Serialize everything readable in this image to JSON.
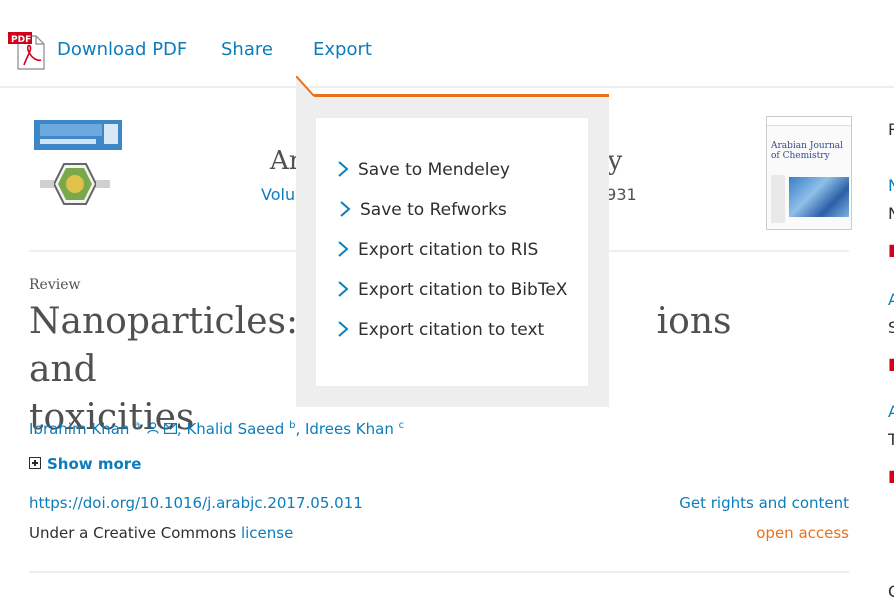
{
  "toolbar": {
    "download_pdf": "Download PDF",
    "share": "Share",
    "export": "Export",
    "pdf_badge": "PDF"
  },
  "journal": {
    "title_left": "Arab",
    "title_right": "stry",
    "volume_left": "Volume",
    "pages_right": "08-931",
    "cover_title": "Arabian Journal of Chemistry"
  },
  "article": {
    "type_label": "Review",
    "title_line1_left": "Nanoparticles: Pro",
    "title_line1_right": "ions and",
    "title_line2": "toxicities",
    "authors": [
      {
        "name": "Ibrahim Khan",
        "sup": "a"
      },
      {
        "name": "Khalid Saeed",
        "sup": "b"
      },
      {
        "name": "Idrees Khan",
        "sup": "c"
      }
    ],
    "show_more": "Show more",
    "doi": "https://doi.org/10.1016/j.arabjc.2017.05.011",
    "license_prefix": "Under a Creative Commons ",
    "license_link": "license",
    "rights": "Get rights and content",
    "open_access": "open access"
  },
  "export_menu": {
    "items": [
      "Save to Mendeley",
      "Save to Refworks",
      "Export citation to RIS",
      "Export citation to BibTeX",
      "Export citation to text"
    ]
  },
  "colors": {
    "link": "#0c7dbb",
    "accent": "#e9711c",
    "text": "#2e2e2e"
  }
}
